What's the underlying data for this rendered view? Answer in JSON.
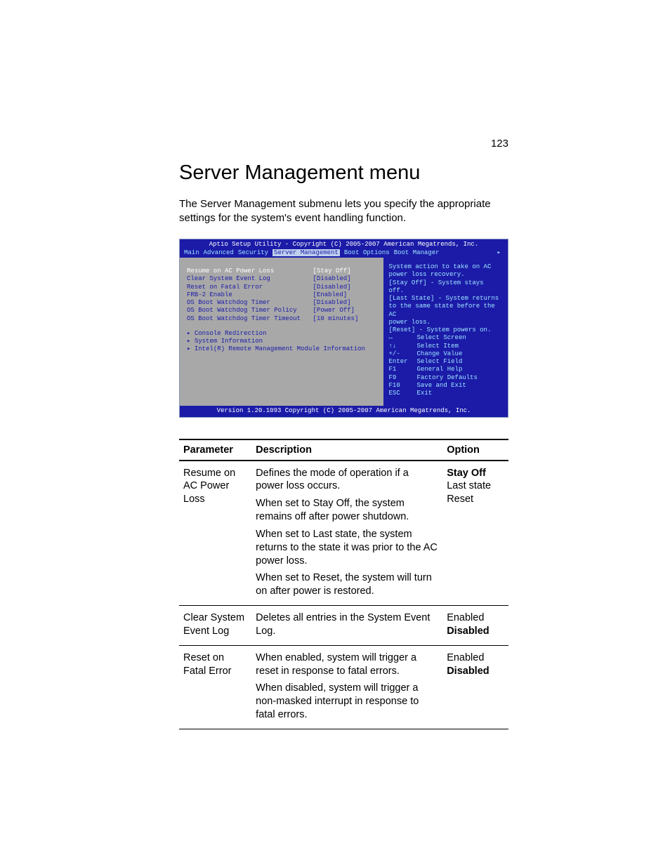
{
  "page_number": "123",
  "heading": "Server Management menu",
  "intro": "The Server Management submenu lets you specify the appropriate settings for the system's event handling function.",
  "bios": {
    "title": "Aptio Setup Utility - Copyright (C) 2005-2007 American Megatrends, Inc.",
    "tabs": [
      "Main",
      "Advanced",
      "Security",
      "Server Management",
      "Boot Options",
      "Boot Manager"
    ],
    "selected_tab": 3,
    "settings": [
      {
        "label": "Resume on AC Power Loss",
        "value": "[Stay Off]",
        "selected": true
      },
      {
        "label": "Clear System Event Log",
        "value": "[Disabled]"
      },
      {
        "label": "Reset on Fatal Error",
        "value": "[Disabled]"
      },
      {
        "label": "",
        "value": ""
      },
      {
        "label": "FRB-2 Enable",
        "value": "[Enabled]"
      },
      {
        "label": "",
        "value": ""
      },
      {
        "label": "OS Boot Watchdog Timer",
        "value": "[Disabled]"
      },
      {
        "label": "OS Boot Watchdog Timer Policy",
        "value": "[Power Off]"
      },
      {
        "label": "OS Boot Watchdog Timer Timeout",
        "value": "[10 minutes]"
      }
    ],
    "submenus": [
      "Console Redirection",
      "System Information",
      "Intel(R) Remote Management Module Information"
    ],
    "help": [
      "System action to take on AC",
      "power loss recovery.",
      "[Stay Off] - System stays off.",
      "[Last State] - System returns",
      "to the same state before the AC",
      "power loss.",
      "[Reset] - System powers on."
    ],
    "keys": [
      {
        "k": "↔",
        "a": "Select Screen"
      },
      {
        "k": "↑↓",
        "a": "Select Item"
      },
      {
        "k": "+/-",
        "a": "Change Value"
      },
      {
        "k": "Enter",
        "a": "Select Field"
      },
      {
        "k": "F1",
        "a": "General Help"
      },
      {
        "k": "F9",
        "a": "Factory Defaults"
      },
      {
        "k": "F10",
        "a": "Save and Exit"
      },
      {
        "k": "ESC",
        "a": "Exit"
      }
    ],
    "footer": "Version 1.20.1093 Copyright (C) 2005-2007 American Megatrends, Inc."
  },
  "table": {
    "headers": [
      "Parameter",
      "Description",
      "Option"
    ],
    "rows": [
      {
        "parameter": "Resume on AC Power Loss",
        "description": [
          "Defines the mode of operation if a power loss occurs.",
          "When set to Stay Off, the system remains off after power shutdown.",
          "When set to Last state, the system returns to the state it was prior to the AC power loss.",
          "When set to Reset, the system will turn on after power is restored."
        ],
        "options": [
          {
            "t": "Stay Off",
            "b": true
          },
          {
            "t": "Last state"
          },
          {
            "t": "Reset"
          }
        ]
      },
      {
        "parameter": "Clear System Event Log",
        "description": [
          "Deletes all entries in the System Event Log."
        ],
        "options": [
          {
            "t": "Enabled"
          },
          {
            "t": "Disabled",
            "b": true
          }
        ]
      },
      {
        "parameter": "Reset on Fatal Error",
        "description": [
          "When enabled, system will trigger a reset in response to fatal errors.",
          "When disabled, system will trigger a non-masked interrupt in response to fatal errors."
        ],
        "options": [
          {
            "t": "Enabled"
          },
          {
            "t": "Disabled",
            "b": true
          }
        ]
      }
    ]
  }
}
